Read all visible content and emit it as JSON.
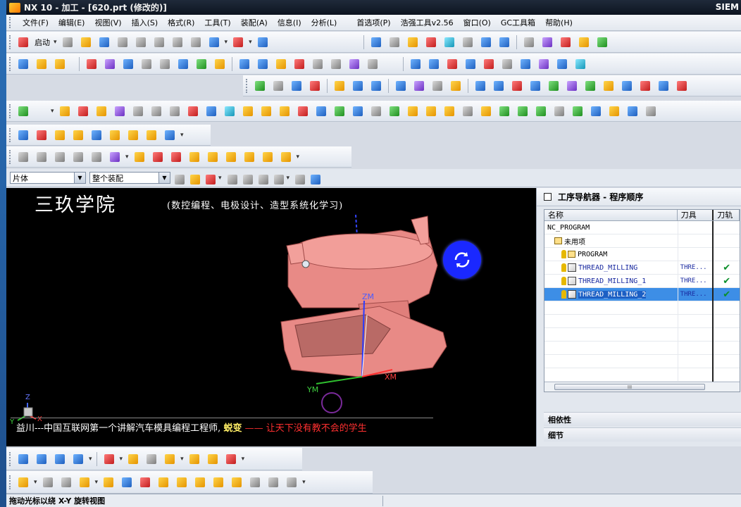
{
  "window": {
    "title": "NX 10 - 加工 - [620.prt (修改的)]",
    "brand": "SIEM"
  },
  "menu": [
    "文件(F)",
    "编辑(E)",
    "视图(V)",
    "插入(S)",
    "格式(R)",
    "工具(T)",
    "装配(A)",
    "信息(I)",
    "分析(L)",
    "首选项(P)",
    "浩强工具v2.56",
    "窗口(O)",
    "GC工具箱",
    "帮助(H)"
  ],
  "toolbar": {
    "start_label": "启动"
  },
  "filter": {
    "type_filter": "片体",
    "scope_filter": "整个装配"
  },
  "viewport": {
    "title": "三玖学院",
    "subtitle": "(数控编程、电极设计、造型系统化学习)",
    "marquee_prefix": "益川---中国互联网第一个讲解汽车模具编程工程师,",
    "marquee_name": "蜕变",
    "marquee_suffix": "—— 让天下没有教不会的学生",
    "axes": {
      "zm": "ZM",
      "xm": "XM",
      "ym": "YM",
      "z": "Z",
      "y": "Y",
      "x": "X"
    }
  },
  "navigator": {
    "title": "工序导航器 - 程序顺序",
    "columns": {
      "name": "名称",
      "tool": "刀具",
      "path": "刀轨"
    },
    "rows": [
      {
        "name": "NC_PROGRAM",
        "tool": "",
        "path": "",
        "level": 0,
        "kind": "root"
      },
      {
        "name": "未用项",
        "tool": "",
        "path": "",
        "level": 1,
        "kind": "group"
      },
      {
        "name": "PROGRAM",
        "tool": "",
        "path": "",
        "level": 2,
        "kind": "group"
      },
      {
        "name": "THREAD_MILLING",
        "tool": "THRE...",
        "path": "✔",
        "level": 2,
        "kind": "op"
      },
      {
        "name": "THREAD_MILLING_1",
        "tool": "THRE...",
        "path": "✔",
        "level": 2,
        "kind": "op"
      },
      {
        "name": "THREAD_MILLING_2",
        "tool": "THRE...",
        "path": "✔",
        "level": 2,
        "kind": "op",
        "selected": true
      }
    ],
    "scroll_grip": "III",
    "sections": {
      "dependency": "相依性",
      "details": "细节"
    }
  },
  "status": {
    "message": "拖动光标以绕 X-Y 旋转视图"
  },
  "colors": {
    "part": "#e88a86",
    "viewport_bg": "#000000",
    "selection": "#3d8ee6",
    "check": "#0a8f2a"
  }
}
